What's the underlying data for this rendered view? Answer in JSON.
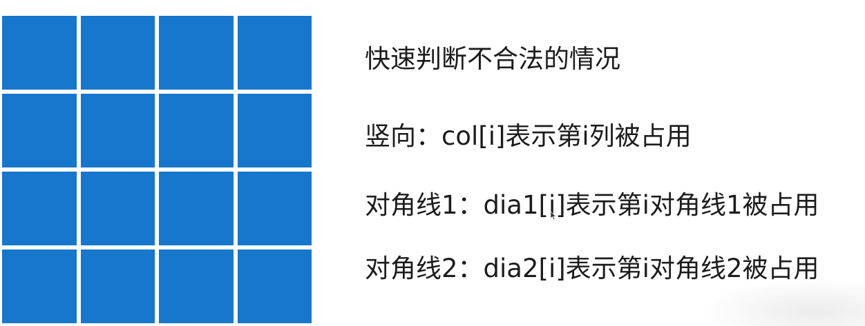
{
  "board": {
    "rows": 4,
    "cols": 4,
    "cell_color": "#1677cc"
  },
  "notes": {
    "title": "快速判断不合法的情况",
    "line1": "竖向：col[i]表示第i列被占用",
    "line2": "对角线1：dia1[i]表示第i对角线1被占用",
    "line3": "对角线2：dia2[i]表示第i对角线2被占用"
  },
  "icons": {
    "cursor": "mouse-cursor-icon"
  }
}
